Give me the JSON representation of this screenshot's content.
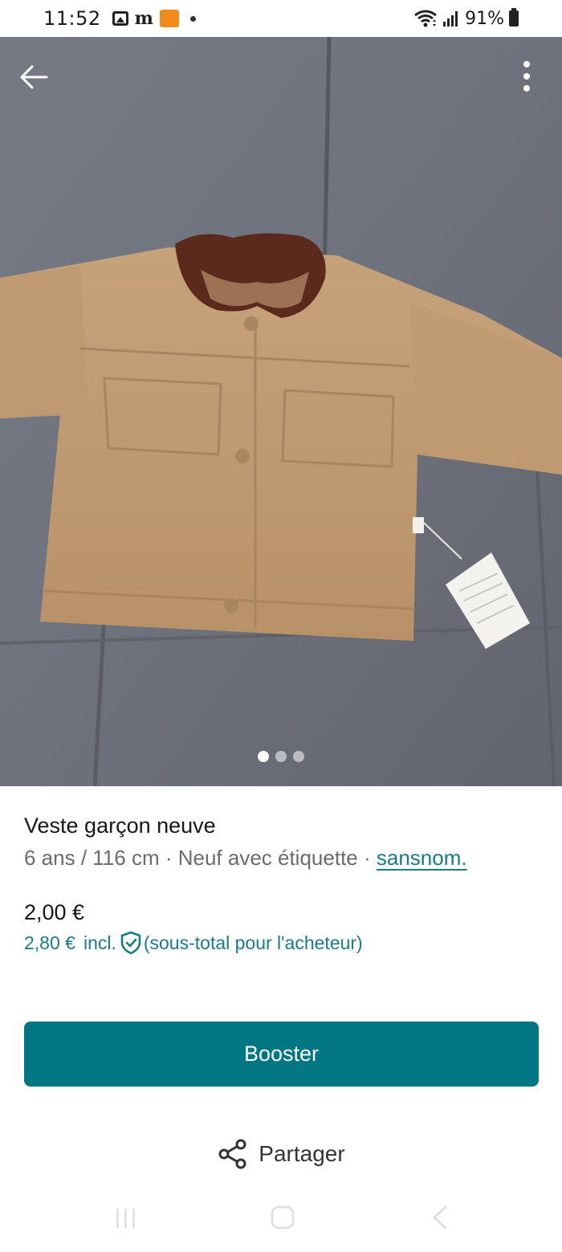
{
  "status_bar": {
    "time": "11:52",
    "battery": "91%",
    "icons": [
      "gallery-icon",
      "m-app-icon",
      "app-badge-icon",
      "notification-dot",
      "wifi-icon",
      "signal-icon",
      "battery-icon"
    ]
  },
  "photo": {
    "pager": {
      "count": 3,
      "active_index": 0
    }
  },
  "item": {
    "title": "Veste garçon neuve",
    "details": "6 ans / 116 cm · Neuf avec étiquette · ",
    "brand": "sansnom.",
    "price": "2,00 €",
    "buyer_total_amount": "2,80 €",
    "buyer_total_incl": "incl.",
    "buyer_total_note": "(sous-total pour l'acheteur)"
  },
  "actions": {
    "booster_label": "Booster",
    "share_label": "Partager"
  },
  "colors": {
    "accent": "#007782",
    "link": "#1a7b86"
  }
}
